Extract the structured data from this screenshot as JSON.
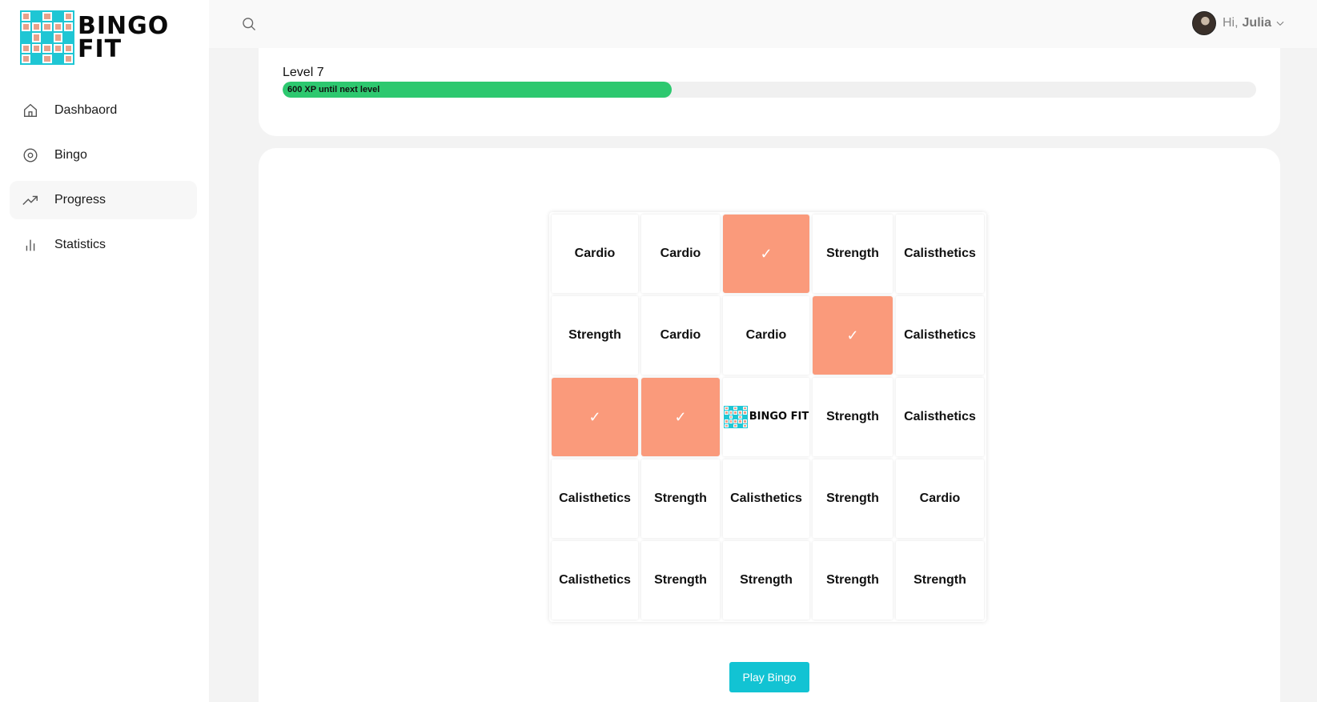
{
  "brand": {
    "line1": "BINGO",
    "line2": "FIT"
  },
  "sidebar": {
    "items": [
      {
        "label": "Dashbaord",
        "icon": "home-icon"
      },
      {
        "label": "Bingo",
        "icon": "target-icon"
      },
      {
        "label": "Progress",
        "icon": "trending-up-icon",
        "active": true
      },
      {
        "label": "Statistics",
        "icon": "bar-chart-icon"
      }
    ]
  },
  "header": {
    "greeting": "Hi,",
    "user_name": "Julia"
  },
  "level": {
    "label": "Level 7",
    "xp_text": "600 XP until next level",
    "progress_percent": 40
  },
  "bingo": {
    "rows": [
      [
        "Cardio",
        "Cardio",
        "✓",
        "Strength",
        "Calisthetics"
      ],
      [
        "Strength",
        "Cardio",
        "Cardio",
        "✓",
        "Calisthetics"
      ],
      [
        "✓",
        "✓",
        "BINGO FIT",
        "Strength",
        "Calisthetics"
      ],
      [
        "Calisthetics",
        "Strength",
        "Calisthetics",
        "Strength",
        "Cardio"
      ],
      [
        "Calisthetics",
        "Strength",
        "Strength",
        "Strength",
        "Strength"
      ]
    ],
    "completed_cells": [
      [
        0,
        2
      ],
      [
        1,
        3
      ],
      [
        2,
        0
      ],
      [
        2,
        1
      ]
    ],
    "center_cell": [
      2,
      2
    ],
    "play_button": "Play Bingo",
    "colors": {
      "completed": "#fa9a7b",
      "button": "#12c3d3"
    }
  }
}
